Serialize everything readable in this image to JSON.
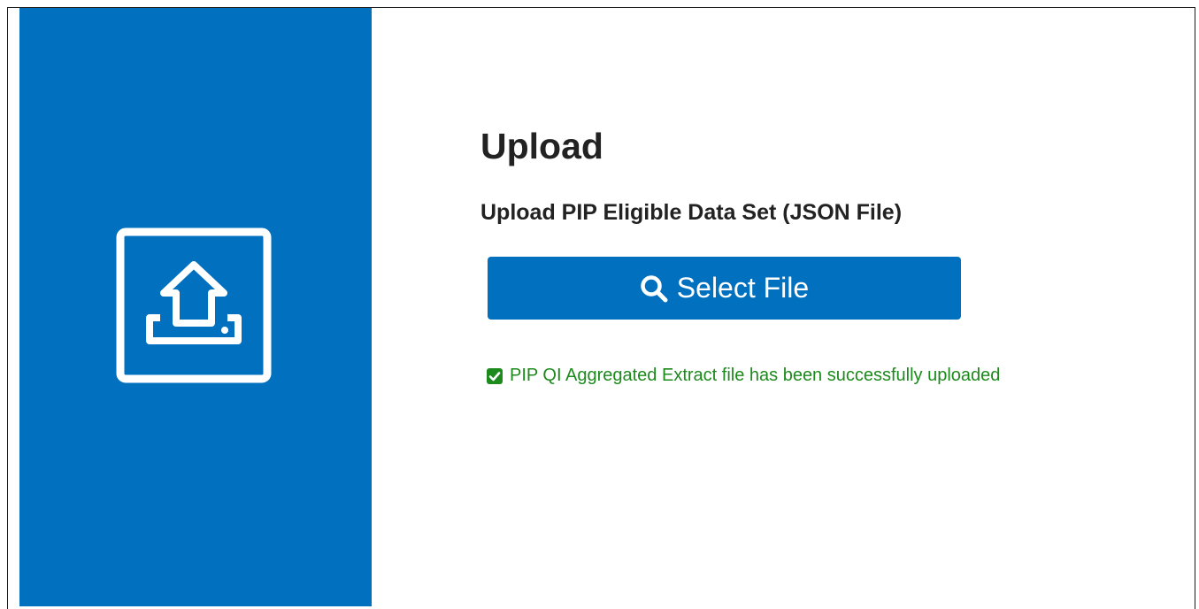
{
  "upload": {
    "title": "Upload",
    "subtitle": "Upload PIP Eligible Data Set (JSON File)",
    "select_button_label": "Select File",
    "status_message": "PIP QI Aggregated Extract file has been successfully uploaded"
  },
  "icons": {
    "illustration": "upload-tray-icon",
    "button": "search-icon",
    "status": "check-square-icon"
  },
  "colors": {
    "brand_blue": "#0070bf",
    "success_green": "#1c8a1c",
    "text_dark": "#222222"
  }
}
